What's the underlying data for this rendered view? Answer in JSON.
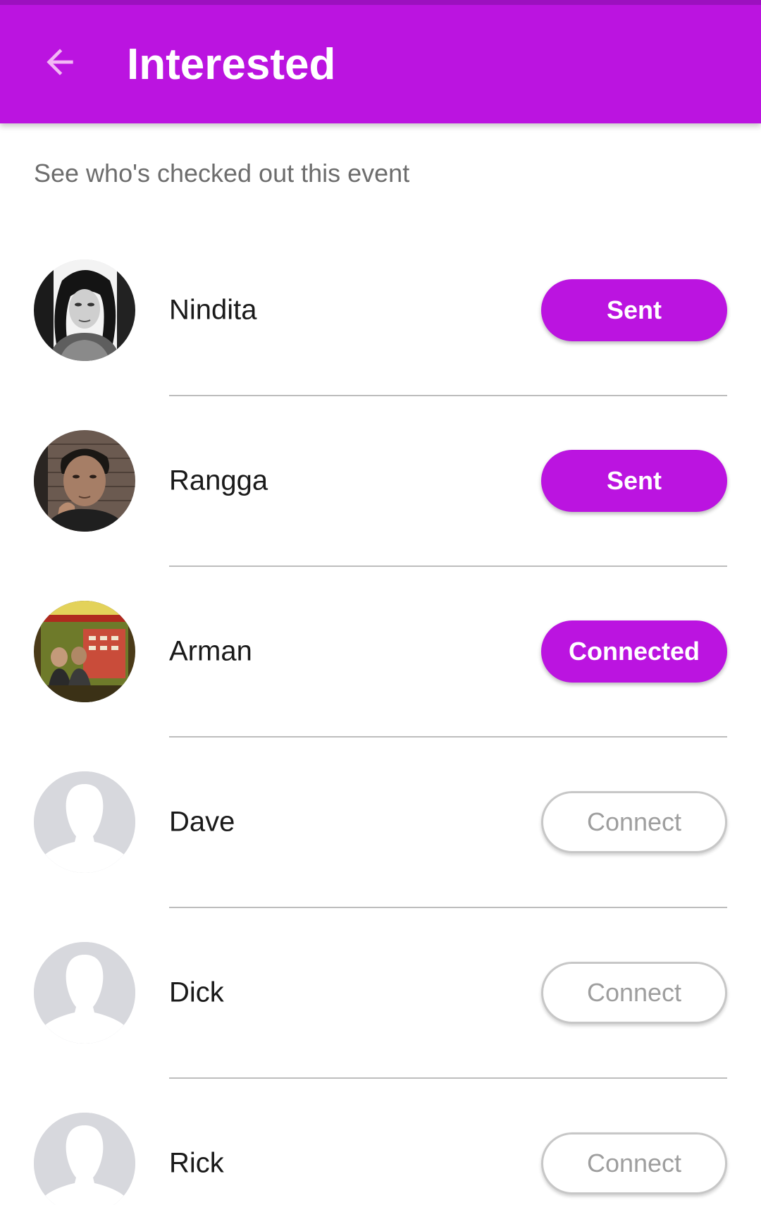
{
  "app_bar": {
    "title": "Interested",
    "back_icon": "arrow-left-icon",
    "color": "#bb14e0"
  },
  "subtitle": "See who's checked out this event",
  "people": [
    {
      "name": "Nindita",
      "button": "Sent",
      "button_style": "filled",
      "avatar": "photo-bw-woman"
    },
    {
      "name": "Rangga",
      "button": "Sent",
      "button_style": "filled",
      "avatar": "photo-man-brick-wall"
    },
    {
      "name": "Arman",
      "button": "Connected",
      "button_style": "filled",
      "avatar": "photo-shop-front"
    },
    {
      "name": "Dave",
      "button": "Connect",
      "button_style": "outline",
      "avatar": "placeholder-person-icon"
    },
    {
      "name": "Dick",
      "button": "Connect",
      "button_style": "outline",
      "avatar": "placeholder-person-icon"
    },
    {
      "name": "Rick",
      "button": "Connect",
      "button_style": "outline",
      "avatar": "placeholder-person-icon"
    }
  ]
}
